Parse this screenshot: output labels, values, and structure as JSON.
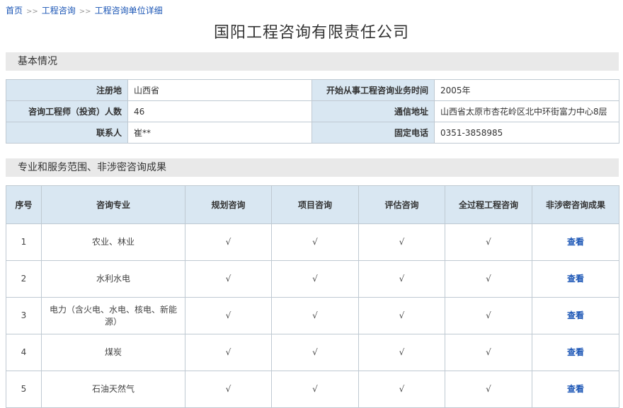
{
  "breadcrumb": {
    "items": [
      "首页",
      "工程咨询",
      "工程咨询单位详细"
    ],
    "separator": ">>"
  },
  "page_title": "国阳工程咨询有限责任公司",
  "basic_info": {
    "section_title": "基本情况",
    "rows": [
      [
        {
          "label": "注册地",
          "value": "山西省"
        },
        {
          "label": "开始从事工程咨询业务时间",
          "value": "2005年"
        }
      ],
      [
        {
          "label": "咨询工程师（投资）人数",
          "value": "46"
        },
        {
          "label": "通信地址",
          "value": "山西省太原市杏花岭区北中环街富力中心8层"
        }
      ],
      [
        {
          "label": "联系人",
          "value": "崔**"
        },
        {
          "label": "固定电话",
          "value": "0351-3858985"
        }
      ]
    ]
  },
  "scope": {
    "section_title": "专业和服务范围、非涉密咨询成果",
    "headers": [
      "序号",
      "咨询专业",
      "规划咨询",
      "项目咨询",
      "评估咨询",
      "全过程工程咨询",
      "非涉密咨询成果"
    ],
    "rows": [
      {
        "no": "1",
        "major": "农业、林业",
        "plan": "√",
        "project": "√",
        "assess": "√",
        "whole": "√",
        "result": "查看"
      },
      {
        "no": "2",
        "major": "水利水电",
        "plan": "√",
        "project": "√",
        "assess": "√",
        "whole": "√",
        "result": "查看"
      },
      {
        "no": "3",
        "major": "电力（含火电、水电、核电、新能源）",
        "plan": "√",
        "project": "√",
        "assess": "√",
        "whole": "√",
        "result": "查看"
      },
      {
        "no": "4",
        "major": "煤炭",
        "plan": "√",
        "project": "√",
        "assess": "√",
        "whole": "√",
        "result": "查看"
      },
      {
        "no": "5",
        "major": "石油天然气",
        "plan": "√",
        "project": "√",
        "assess": "√",
        "whole": "√",
        "result": "查看"
      }
    ]
  },
  "colors": {
    "link": "#1a55b5",
    "header_bg": "#d9e7f2",
    "section_bg": "#e9e9e9",
    "border": "#bfc9d2"
  }
}
